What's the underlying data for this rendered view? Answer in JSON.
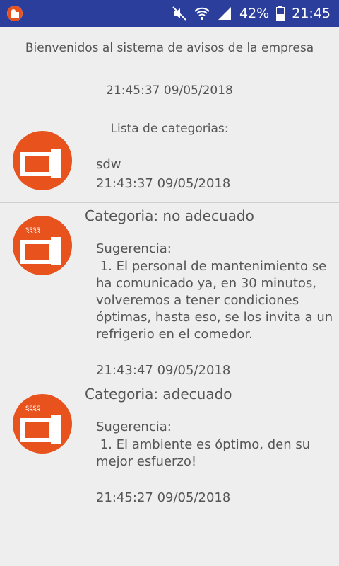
{
  "statusbar": {
    "battery_percent": "42%",
    "time": "21:45",
    "icons": [
      "mute-icon",
      "wifi-icon",
      "signal-icon",
      "battery-icon"
    ]
  },
  "header": {
    "welcome": "Bienvenidos al sistema de avisos de la empresa",
    "timestamp": "21:45:37 09/05/2018",
    "list_title": "Lista de categorias:"
  },
  "items": [
    {
      "category": "",
      "suggestion_label": "",
      "suggestion": "sdw",
      "timestamp": "21:43:37 09/05/2018"
    },
    {
      "category": "Categoria: no adecuado",
      "suggestion_label": "Sugerencia:",
      "suggestion": " 1. El personal de mantenimiento se ha comunicado ya, en 30 minutos, volveremos a tener condiciones óptimas, hasta eso, se los invita a un refrigerio en el comedor.",
      "timestamp": "21:43:47 09/05/2018"
    },
    {
      "category": "Categoria: adecuado",
      "suggestion_label": "Sugerencia:",
      "suggestion": " 1. El ambiente es óptimo, den su mejor esfuerzo!",
      "timestamp": "21:45:27 09/05/2018"
    }
  ],
  "colors": {
    "statusbar": "#2b3e9c",
    "avatar": "#e8531d",
    "background": "#eeeeee"
  }
}
